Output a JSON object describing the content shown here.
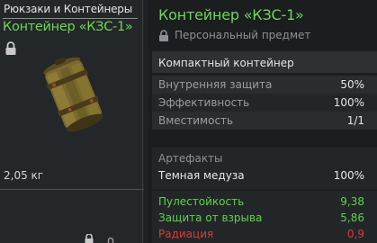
{
  "left": {
    "category": "Рюкзаки и Контейнеры",
    "item_name": "Контейнер «КЗС-1»",
    "weight": "2,05 кг"
  },
  "tooltip": {
    "title": "Контейнер «КЗС-1»",
    "personal": "Персональный предмет",
    "description": "Компактный контейнер",
    "stats": [
      {
        "label": "Внутренняя защита",
        "value": "50%"
      },
      {
        "label": "Эффективность",
        "value": "100%"
      },
      {
        "label": "Вместимость",
        "value": "1/1"
      }
    ],
    "artifacts_header": "Артефакты",
    "artifact": {
      "name": "Темная медуза",
      "value": "100%"
    },
    "properties": [
      {
        "label": "Пулестойкость",
        "value": "9,38",
        "color": "#5fd14a"
      },
      {
        "label": "Защита от взрыва",
        "value": "5,86",
        "color": "#5fd14a"
      },
      {
        "label": "Радиация",
        "value": "0,9",
        "color": "#d93b34"
      }
    ]
  },
  "colors": {
    "accent": "#5fc348",
    "title_green": "#6fd65c",
    "positive": "#5fd14a",
    "negative": "#d93b34"
  },
  "icons": [
    "lock-icon",
    "container-item-icon"
  ]
}
